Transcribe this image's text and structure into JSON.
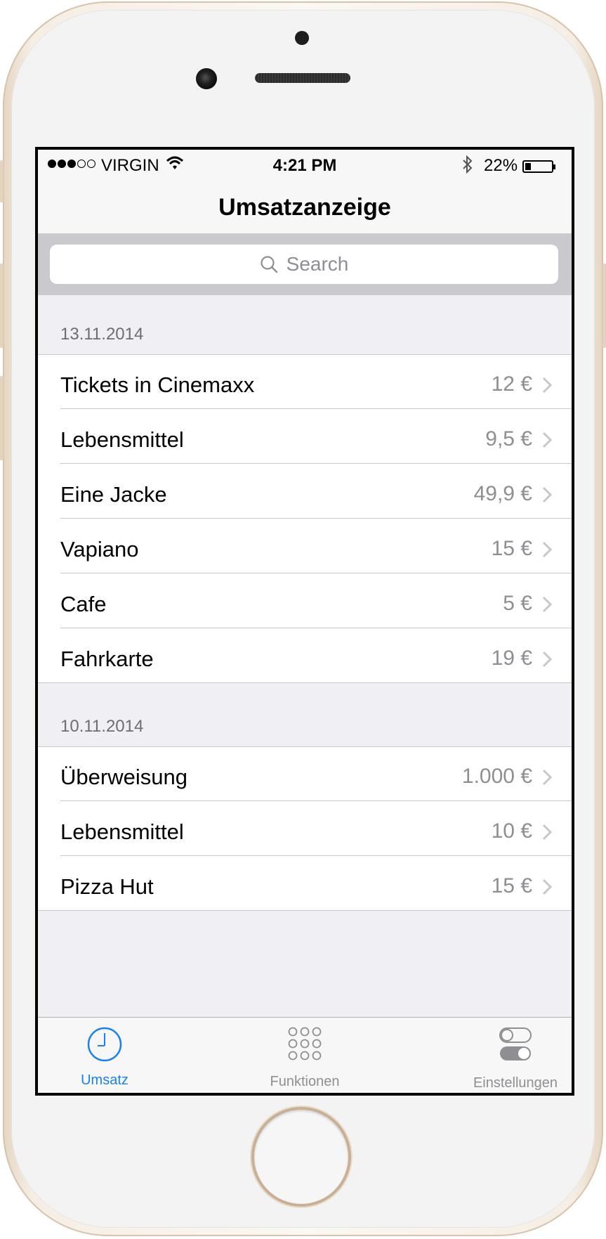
{
  "status_bar": {
    "carrier": "VIRGIN",
    "time": "4:21 PM",
    "battery": "22%",
    "battery_level": 0.22,
    "signal_bars_filled": 3,
    "signal_bars_total": 5
  },
  "nav": {
    "title": "Umsatzanzeige"
  },
  "search": {
    "placeholder": "Search"
  },
  "sections": [
    {
      "date": "13.11.2014",
      "rows": [
        {
          "label": "Tickets in Cinemaxx",
          "value": "12 €"
        },
        {
          "label": "Lebensmittel",
          "value": "9,5 €"
        },
        {
          "label": "Eine Jacke",
          "value": "49,9 €"
        },
        {
          "label": "Vapiano",
          "value": "15 €"
        },
        {
          "label": "Cafe",
          "value": "5 €"
        },
        {
          "label": "Fahrkarte",
          "value": "19 €"
        }
      ]
    },
    {
      "date": "10.11.2014",
      "rows": [
        {
          "label": "Überweisung",
          "value": "1.000 €"
        },
        {
          "label": "Lebensmittel",
          "value": "10 €"
        },
        {
          "label": "Pizza Hut",
          "value": "15 €"
        }
      ]
    }
  ],
  "tab_bar": {
    "tabs": [
      {
        "label": "Umsatz",
        "icon": "clock-icon",
        "selected": true
      },
      {
        "label": "Funktionen",
        "icon": "grid-dots-icon",
        "selected": false
      },
      {
        "label": "Einstellungen",
        "icon": "toggles-icon",
        "selected": false
      }
    ]
  },
  "colors": {
    "tint": "#1a82f0",
    "inactive": "#8e8e93",
    "group_background": "#efeff4"
  }
}
